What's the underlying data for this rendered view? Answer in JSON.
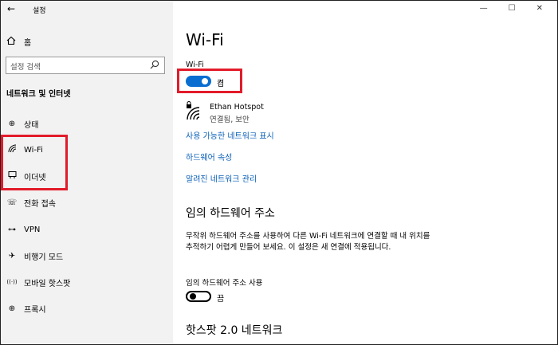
{
  "window": {
    "title": "설정",
    "back_glyph": "←",
    "minimize_glyph": "—",
    "maximize_glyph": "☐",
    "close_glyph": "✕"
  },
  "sidebar": {
    "home_label": "홈",
    "search_placeholder": "설정 검색",
    "section_title": "네트워크 및 인터넷",
    "items": [
      {
        "label": "상태",
        "icon": "globe-icon",
        "glyph": "⊕"
      },
      {
        "label": "Wi-Fi",
        "icon": "wifi-icon",
        "glyph": "◜"
      },
      {
        "label": "이더넷",
        "icon": "ethernet-icon",
        "glyph": "⊟"
      },
      {
        "label": "전화 접속",
        "icon": "dialup-icon",
        "glyph": "☏"
      },
      {
        "label": "VPN",
        "icon": "vpn-icon",
        "glyph": "⊶"
      },
      {
        "label": "비행기 모드",
        "icon": "airplane-icon",
        "glyph": "✈"
      },
      {
        "label": "모바일 핫스팟",
        "icon": "hotspot-icon",
        "glyph": "((·))"
      },
      {
        "label": "프록시",
        "icon": "proxy-globe-icon",
        "glyph": "⊕"
      }
    ]
  },
  "main": {
    "title": "Wi-Fi",
    "wifi_label": "Wi-Fi",
    "wifi_toggle_state": "켬",
    "network": {
      "name": "Ethan Hotspot",
      "status": "연결됨, 보안"
    },
    "links": [
      "사용 가능한 네트워크 표시",
      "하드웨어 속성",
      "알려진 네트워크 관리"
    ],
    "random_mac": {
      "heading": "임의 하드웨어 주소",
      "description": "무작위 하드웨어 주소를 사용하여 다른 Wi-Fi 네트워크에 연결할 때 내 위치를 추적하기 어렵게 만들어 보세요. 이 설정은 새 연결에 적용됩니다.",
      "toggle_label": "임의 하드웨어 주소 사용",
      "toggle_state": "끔"
    },
    "hotspot_heading": "핫스팟 2.0 네트워크"
  },
  "colors": {
    "accent": "#0a6ed1",
    "link": "#0a5fb8",
    "highlight": "#e21b2a",
    "sidebar_bg": "#f2f2f2"
  }
}
